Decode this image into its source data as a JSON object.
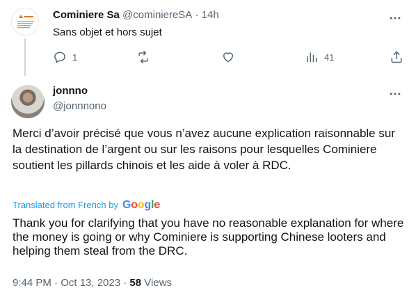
{
  "parent_tweet": {
    "name": "Cominiere Sa",
    "handle": "@cominiereSA",
    "time": "· 14h",
    "text": "Sans objet et hors sujet",
    "replies": "1",
    "views": "41"
  },
  "main_tweet": {
    "name": "jonnno",
    "handle": "@jonnnono",
    "text": "Merci d’avoir précisé que vous n’avez aucune explication raisonnable sur la destination de l’argent ou sur les raisons pour lesquelles Cominiere soutient les pillards chinois et les aide à voler à RDC.",
    "translated_label": "Translated from French by",
    "translator": "Google",
    "translation": "Thank you for clarifying that you have no reasonable explanation for where the money is going or why Cominiere is supporting Chinese looters and helping them steal from the DRC.",
    "timestamp": "9:44 PM · Oct 13, 2023 · ",
    "views_count": "58",
    "views_label": "Views"
  },
  "colors": {
    "text": "#0f1419",
    "secondary": "#536471",
    "link": "#1d9bf0",
    "thread_line": "#cfd9de"
  },
  "icons": [
    "more-icon",
    "reply-icon",
    "retweet-icon",
    "like-icon",
    "analytics-icon",
    "share-icon",
    "google-logo"
  ]
}
